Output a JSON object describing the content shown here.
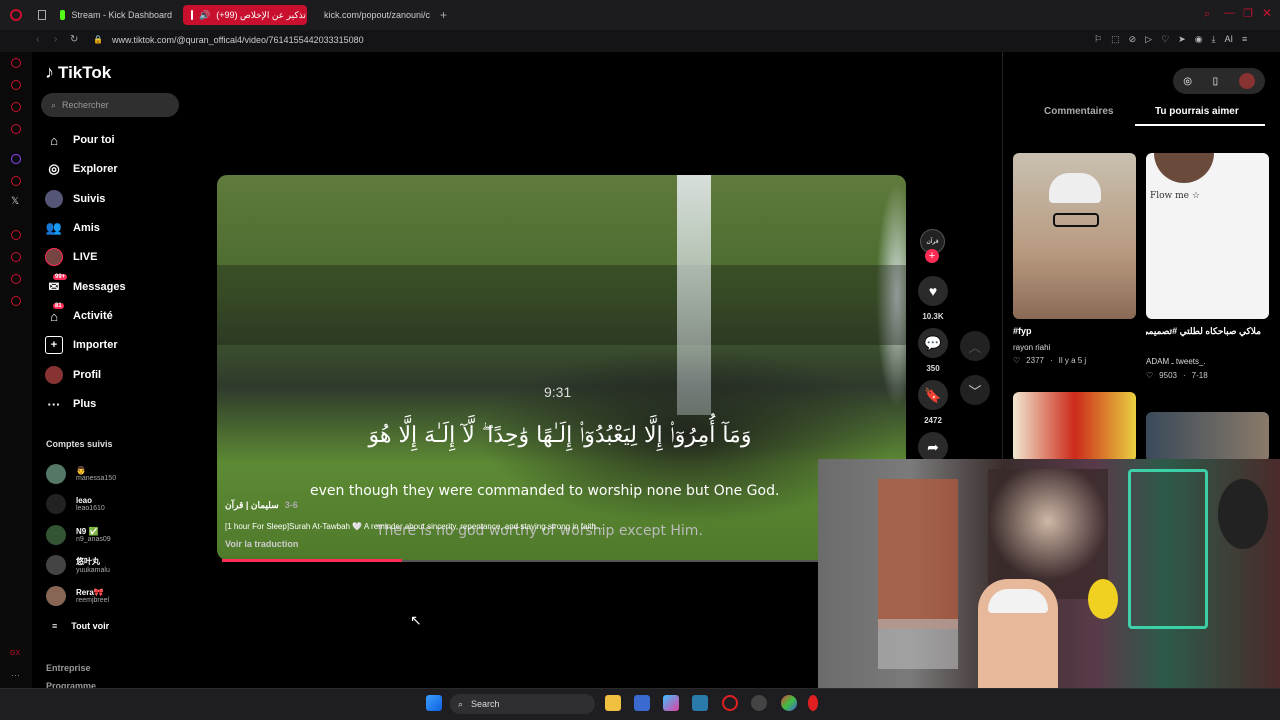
{
  "browser": {
    "tabs": [
      {
        "label": "Stream - Kick Dashboard"
      },
      {
        "label": "(+99) تذكير عن الإخلاص"
      },
      {
        "label": "kick.com/popout/zanouni/c"
      }
    ],
    "url": "www.tiktok.com/@quran_offical4/video/7614155442033315080",
    "ai_label": "AI"
  },
  "tiktok": {
    "logo": "TikTok",
    "search_placeholder": "Rechercher",
    "nav": [
      {
        "label": "Pour toi",
        "icon": "home-icon"
      },
      {
        "label": "Explorer",
        "icon": "compass-icon"
      },
      {
        "label": "Suivis",
        "icon": "following-icon"
      },
      {
        "label": "Amis",
        "icon": "friends-icon"
      },
      {
        "label": "LIVE",
        "icon": "live-icon"
      },
      {
        "label": "Messages",
        "icon": "message-icon",
        "badge": "99+"
      },
      {
        "label": "Activité",
        "icon": "activity-icon",
        "badge": "81"
      },
      {
        "label": "Importer",
        "icon": "upload-icon"
      },
      {
        "label": "Profil",
        "icon": "profile-icon"
      },
      {
        "label": "Plus",
        "icon": "more-icon"
      }
    ],
    "following_title": "Comptes suivis",
    "following": [
      {
        "name": "👨",
        "handle": "manessa150"
      },
      {
        "name": "leao",
        "handle": "leao1610"
      },
      {
        "name": "N9 ✅",
        "handle": "n9_anas09"
      },
      {
        "name": "悠叶丸",
        "handle": "yuukamalu"
      },
      {
        "name": "Rera🎀",
        "handle": "reemjbreel"
      }
    ],
    "see_all": "Tout voir",
    "footer": [
      "Entreprise",
      "Programme"
    ]
  },
  "video": {
    "time_overlay": "9:31",
    "arabic_text": "وَمَآ أُمِرُوٓا۟ إِلَّا لِيَعْبُدُوٓا۟ إِلَـٰهًا وَٰحِدًا ۖ لَّآ إِلَـٰهَ إِلَّا هُوَ",
    "subtitle_1": "even though they were commanded to worship none but One God.",
    "subtitle_2": "There is no god worthy of worship except Him.",
    "author": "سليمان | قرآن",
    "date": "3-6",
    "description": "[1 hour For Sleep]Surah At-Tawbah 🤍 A reminder about sincerity, repentance, and staying strong in faith...",
    "translate": "Voir la traduction",
    "progress_fraction": 0.3,
    "actions": {
      "likes": "10.3K",
      "comments": "350",
      "saves": "2472"
    }
  },
  "right_panel": {
    "tabs": [
      "Commentaires",
      "Tu pourrais aimer"
    ],
    "recommendations": [
      {
        "title": "#fyp",
        "user": "rayon riahi",
        "likes": "2377",
        "age": "Il y a 5 j"
      },
      {
        "title": "ملاكي صباحكاه لطلتي #تصميمي 🎬 🎶 #تصاميم_فيديوهات",
        "user": "ADAM ـ tweets_.",
        "likes": "9503",
        "age": "7-18",
        "overlay": "Flow me ☆"
      }
    ]
  },
  "taskbar": {
    "search": "Search"
  },
  "colors": {
    "accent": "#fe2c55",
    "opera": "#c8102e",
    "kick": "#53fc18"
  }
}
